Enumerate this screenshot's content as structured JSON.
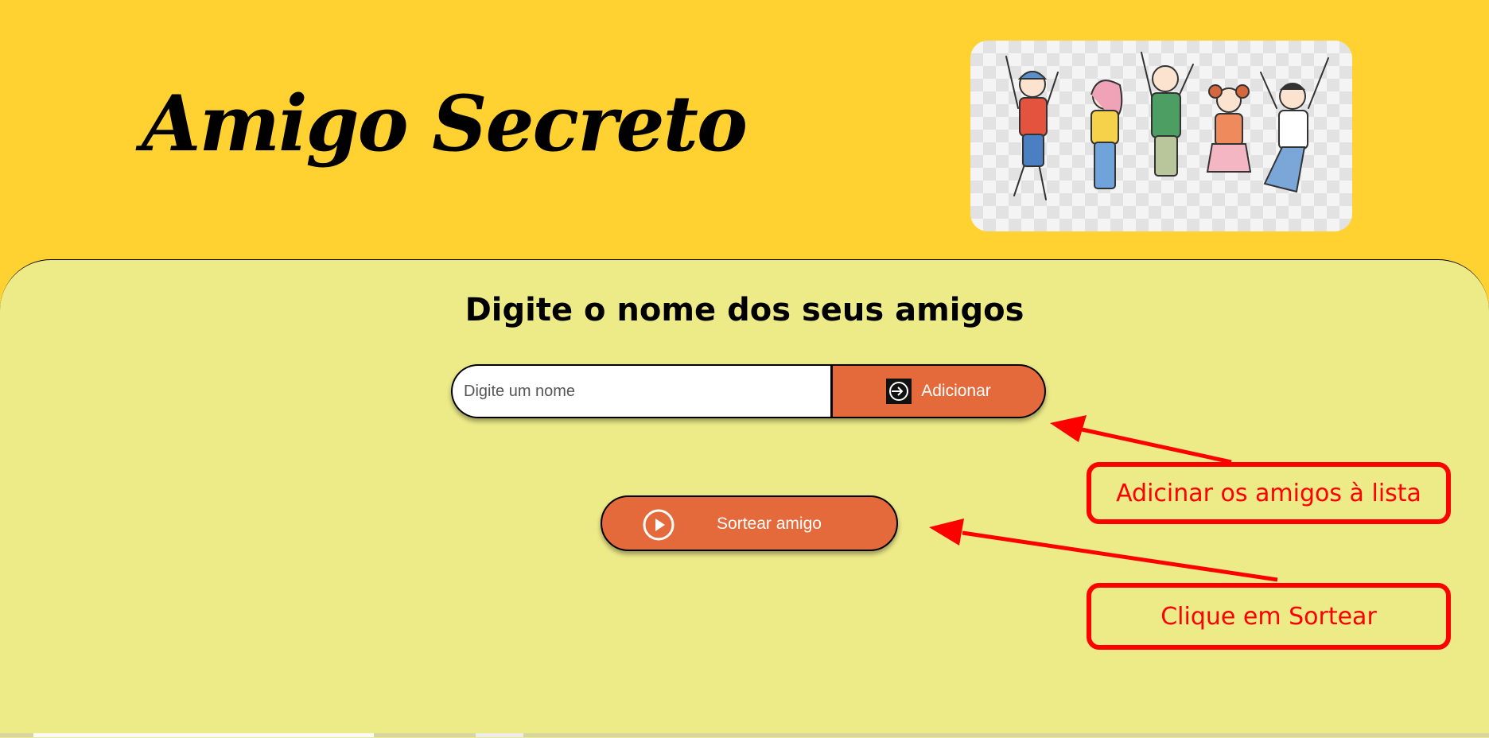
{
  "header": {
    "title": "Amigo Secreto",
    "illustration": "friends-jumping-illustration"
  },
  "main": {
    "subtitle": "Digite o nome dos seus amigos",
    "input": {
      "placeholder": "Digite um nome",
      "value": ""
    },
    "add_button": {
      "label": "Adicionar",
      "icon": "enter-icon"
    },
    "draw_button": {
      "label": "Sortear amigo",
      "icon": "play-circle-icon"
    }
  },
  "annotations": {
    "callout_add": "Adicinar os amigos à lista",
    "callout_draw": "Clique em Sortear"
  },
  "colors": {
    "header_bg": "#FFD232",
    "main_bg": "#EDEA88",
    "button_bg": "#E4693B",
    "annotation": "#FF0000"
  }
}
